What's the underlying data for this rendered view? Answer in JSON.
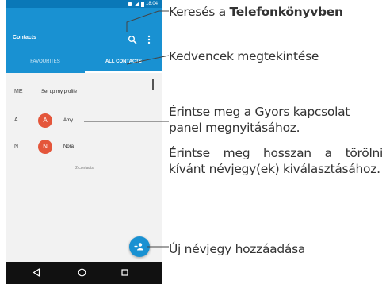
{
  "status_bar": {
    "time": "18:04"
  },
  "app_bar": {
    "title": "Contacts",
    "search_icon": "search-icon",
    "menu_icon": "more-vert-icon"
  },
  "tabs": [
    {
      "label": "FAVOURITES",
      "selected": false
    },
    {
      "label": "ALL CONTACTS",
      "selected": true
    }
  ],
  "profile_row": {
    "section": "ME",
    "label": "Set up my profile"
  },
  "contacts": [
    {
      "section": "A",
      "initial": "A",
      "name": "Amy",
      "avatar_color": "#e4563b"
    },
    {
      "section": "N",
      "initial": "N",
      "name": "Nora",
      "avatar_color": "#e4563b"
    }
  ],
  "contacts_count": "2 contacts",
  "fab": {
    "icon": "add-person-icon",
    "color": "#1991d2"
  },
  "nav_bar": {
    "icons": [
      "back-icon",
      "home-icon",
      "recents-icon"
    ]
  },
  "colors": {
    "primary": "#1991d2",
    "status_bar": "#0a78b8",
    "avatar": "#e4563b"
  },
  "callouts": {
    "search_prefix": "Keresés a ",
    "search_bold": "Telefonkönyvben",
    "favourites": "Kedvencek megtekintése",
    "quick_contact_line1": "Érintse meg a Gyors kapcsolat",
    "quick_contact_line2": "panel megnyitásához.",
    "long_press": "Érintse meg hosszan a törölni kívánt névjegy(ek) kiválasztásához.",
    "add_contact": "Új névjegy hozzáadása"
  }
}
